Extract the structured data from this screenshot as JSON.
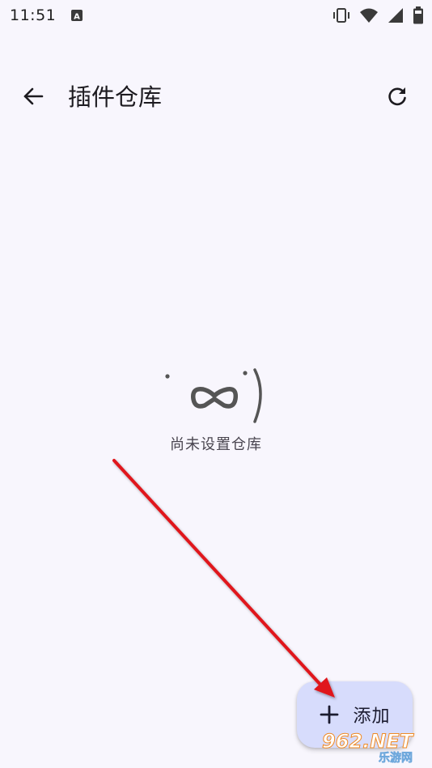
{
  "status_bar": {
    "time": "11:51",
    "notification_glyph": "A",
    "icons": [
      "vibrate-icon",
      "wifi-icon",
      "signal-icon",
      "battery-icon"
    ]
  },
  "app_bar": {
    "title": "插件仓库",
    "back_icon": "arrow-left-icon",
    "refresh_icon": "refresh-icon"
  },
  "empty_state": {
    "message": "尚未设置仓库"
  },
  "fab": {
    "label": "添加",
    "icon": "plus-icon"
  },
  "watermark": {
    "text": "962.NET",
    "subtext": "乐游网"
  },
  "colors": {
    "background": "#f8f6fd",
    "fab": "#d7dcfc",
    "annotation_arrow": "#e0151b"
  }
}
